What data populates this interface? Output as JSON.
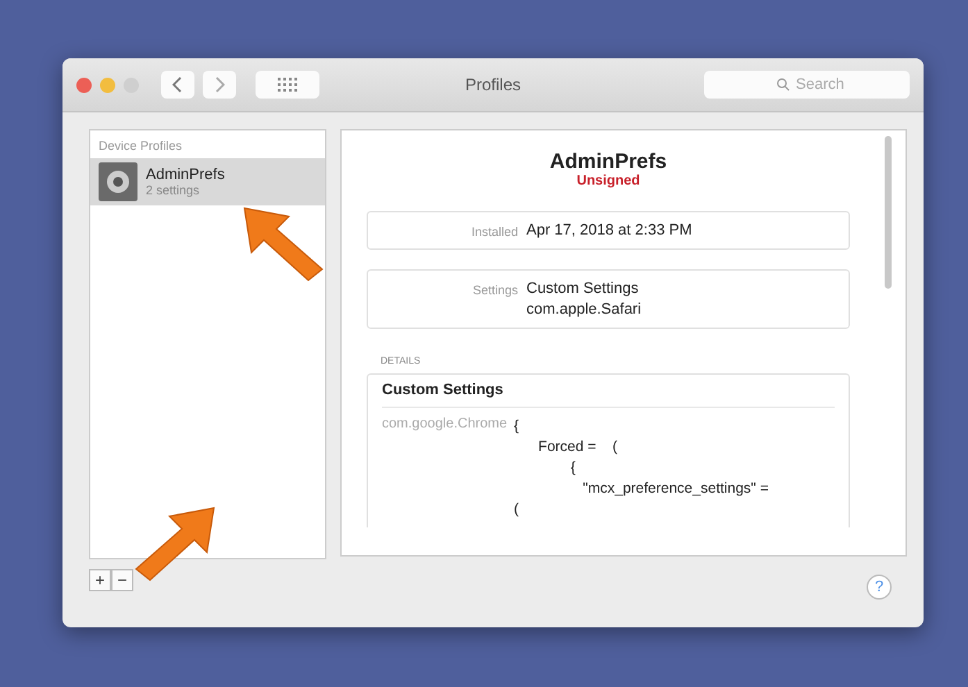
{
  "window": {
    "title": "Profiles",
    "search": {
      "placeholder": "Search"
    }
  },
  "sidebar": {
    "heading": "Device Profiles",
    "items": [
      {
        "name": "AdminPrefs",
        "subtitle": "2 settings",
        "selected": true
      }
    ]
  },
  "footer": {
    "buttons": [
      "+",
      "−"
    ],
    "help": "?"
  },
  "detail": {
    "title": "AdminPrefs",
    "status": "Unsigned",
    "fields": [
      {
        "label": "Installed",
        "values": [
          "Apr 17, 2018 at 2:33 PM"
        ]
      },
      {
        "label": "Settings",
        "values": [
          "Custom Settings",
          "com.apple.Safari"
        ]
      }
    ],
    "details_heading": "DETAILS",
    "details": {
      "title": "Custom Settings",
      "key": "com.google.Chrome",
      "lines": [
        "{",
        "      Forced =    (",
        "              {",
        "                 \"mcx_preference_settings\" =",
        "("
      ]
    }
  }
}
